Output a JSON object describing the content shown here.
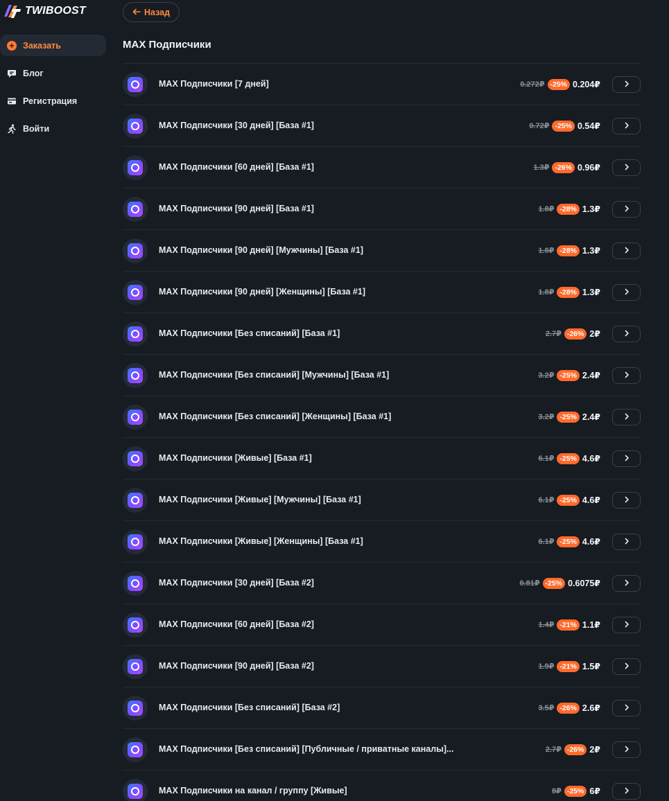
{
  "brand": {
    "name": "TWIBOOST"
  },
  "nav": [
    {
      "label": "Заказать",
      "icon": "plus-circle-icon",
      "active": true
    },
    {
      "label": "Блог",
      "icon": "chat-icon",
      "active": false
    },
    {
      "label": "Регистрация",
      "icon": "card-icon",
      "active": false
    },
    {
      "label": "Войти",
      "icon": "walk-icon",
      "active": false
    }
  ],
  "back_label": "Назад",
  "page_title": "MAX Подписчики",
  "colors": {
    "accent": "#ff8a3d",
    "discount": "#ff6b2c",
    "background": "#171b22"
  },
  "services": [
    {
      "name": "MAX Подписчики [7 дней]",
      "old_price": "0.272₽",
      "discount": "-25%",
      "price": "0.204₽"
    },
    {
      "name": "MAX Подписчики [30 дней] [База #1]",
      "old_price": "0.72₽",
      "discount": "-25%",
      "price": "0.54₽"
    },
    {
      "name": "MAX Подписчики [60 дней] [База #1]",
      "old_price": "1.3₽",
      "discount": "-26%",
      "price": "0.96₽"
    },
    {
      "name": "MAX Подписчики [90 дней] [База #1]",
      "old_price": "1.8₽",
      "discount": "-28%",
      "price": "1.3₽"
    },
    {
      "name": "MAX Подписчики [90 дней] [Мужчины] [База #1]",
      "old_price": "1.8₽",
      "discount": "-28%",
      "price": "1.3₽"
    },
    {
      "name": "MAX Подписчики [90 дней] [Женщины] [База #1]",
      "old_price": "1.8₽",
      "discount": "-28%",
      "price": "1.3₽"
    },
    {
      "name": "MAX Подписчики [Без списаний] [База #1]",
      "old_price": "2.7₽",
      "discount": "-26%",
      "price": "2₽"
    },
    {
      "name": "MAX Подписчики [Без списаний] [Мужчины] [База #1]",
      "old_price": "3.2₽",
      "discount": "-25%",
      "price": "2.4₽"
    },
    {
      "name": "MAX Подписчики [Без списаний] [Женщины] [База #1]",
      "old_price": "3.2₽",
      "discount": "-25%",
      "price": "2.4₽"
    },
    {
      "name": "MAX Подписчики [Живые] [База #1]",
      "old_price": "6.1₽",
      "discount": "-25%",
      "price": "4.6₽"
    },
    {
      "name": "MAX Подписчики [Живые] [Мужчины] [База #1]",
      "old_price": "6.1₽",
      "discount": "-25%",
      "price": "4.6₽"
    },
    {
      "name": "MAX Подписчики [Живые] [Женщины] [База #1]",
      "old_price": "6.1₽",
      "discount": "-25%",
      "price": "4.6₽"
    },
    {
      "name": "MAX Подписчики [30 дней] [База #2]",
      "old_price": "0.81₽",
      "discount": "-25%",
      "price": "0.6075₽"
    },
    {
      "name": "MAX Подписчики [60 дней] [База #2]",
      "old_price": "1.4₽",
      "discount": "-21%",
      "price": "1.1₽"
    },
    {
      "name": "MAX Подписчики [90 дней] [База #2]",
      "old_price": "1.9₽",
      "discount": "-21%",
      "price": "1.5₽"
    },
    {
      "name": "MAX Подписчики [Без списаний] [База #2]",
      "old_price": "3.5₽",
      "discount": "-26%",
      "price": "2.6₽"
    },
    {
      "name": "MAX Подписчики [Без списаний] [Публичные / приватные каналы]...",
      "old_price": "2.7₽",
      "discount": "-26%",
      "price": "2₽"
    },
    {
      "name": "MAX Подписчики на канал / группу [Живые]",
      "old_price": "8₽",
      "discount": "-25%",
      "price": "6₽"
    }
  ]
}
